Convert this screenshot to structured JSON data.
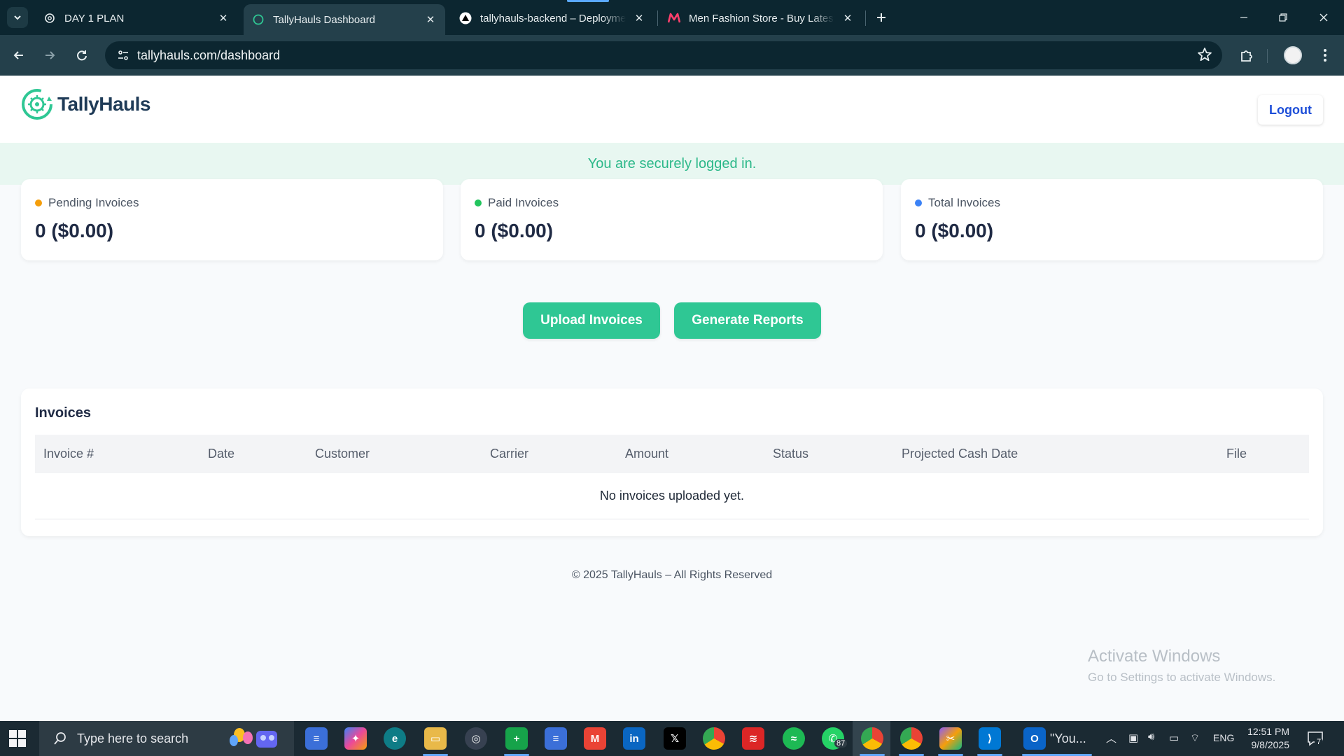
{
  "browser": {
    "tabs": [
      {
        "title": "DAY 1 PLAN",
        "icon": "openai-icon",
        "active": false
      },
      {
        "title": "TallyHauls Dashboard",
        "icon": "tallyhauls-icon",
        "active": true
      },
      {
        "title": "tallyhauls-backend – Deployme",
        "icon": "vercel-icon",
        "active": false
      },
      {
        "title": "Men Fashion Store - Buy Latest",
        "icon": "myntra-icon",
        "active": false
      }
    ],
    "url": "tallyhauls.com/dashboard"
  },
  "header": {
    "brand_name": "TallyHauls",
    "logout_label": "Logout"
  },
  "alert": {
    "message": "You are securely logged in."
  },
  "stats": [
    {
      "label": "Pending Invoices",
      "value": "0 ($0.00)",
      "dot_color": "#f59e0b"
    },
    {
      "label": "Paid Invoices",
      "value": "0 ($0.00)",
      "dot_color": "#22c55e"
    },
    {
      "label": "Total Invoices",
      "value": "0 ($0.00)",
      "dot_color": "#3b82f6"
    }
  ],
  "actions": {
    "upload_label": "Upload Invoices",
    "reports_label": "Generate Reports"
  },
  "invoices": {
    "title": "Invoices",
    "columns": [
      "Invoice #",
      "Date",
      "Customer",
      "Carrier",
      "Amount",
      "Status",
      "Projected Cash Date",
      "File"
    ],
    "empty_message": "No invoices uploaded yet."
  },
  "footer": {
    "text": "© 2025 TallyHauls – All Rights Reserved"
  },
  "watermark": {
    "line1": "Activate Windows",
    "line2": "Go to Settings to activate Windows."
  },
  "taskbar": {
    "search_placeholder": "Type here to search",
    "whatsapp_badge": "87",
    "outlook_label": "\"You...",
    "language": "ENG",
    "time": "12:51 PM",
    "date": "9/8/2025",
    "notification_count": "7"
  },
  "colors": {
    "accent_green": "#2fc794",
    "brand_navy": "#1f3b57",
    "logout_blue": "#1d4ed8",
    "alert_bg": "#e8f7f1"
  }
}
